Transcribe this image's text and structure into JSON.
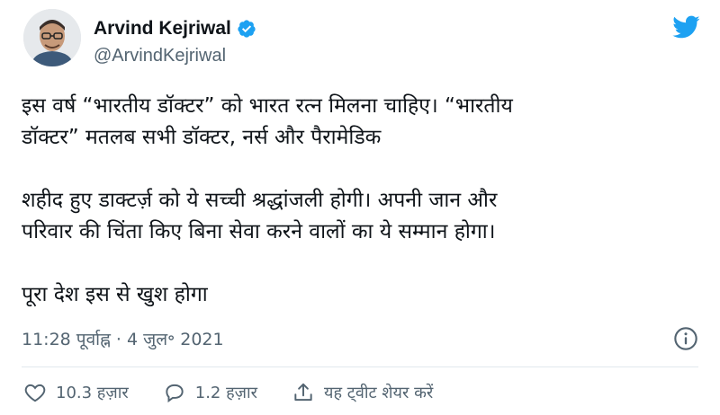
{
  "author": {
    "display_name": "Arvind Kejriwal",
    "handle": "@ArvindKejriwal",
    "verified": true,
    "avatar_icon": "profile-photo"
  },
  "brand": {
    "logo_icon": "twitter-bird-icon",
    "color": "#1da1f2"
  },
  "tweet": {
    "lines": [
      "इस वर्ष “भारतीय डॉक्टर” को भारत रत्न मिलना चाहिए। “भारतीय",
      "डॉक्टर” मतलब सभी डॉक्टर, नर्स और पैरामेडिक",
      "",
      "शहीद हुए डाक्टर्ज़ को ये सच्ची श्रद्धांजली होगी। अपनी जान और",
      "परिवार की चिंता किए बिना सेवा करने वालों का ये सम्मान होगा।",
      "",
      "पूरा देश इस से खुश होगा"
    ]
  },
  "meta": {
    "timestamp": "11:28 पूर्वाह्न · 4 जुल॰ 2021"
  },
  "actions": {
    "like_count": "10.3 हज़ार",
    "reply_count": "1.2 हज़ार",
    "share_label": "यह ट्वीट शेयर करें"
  }
}
